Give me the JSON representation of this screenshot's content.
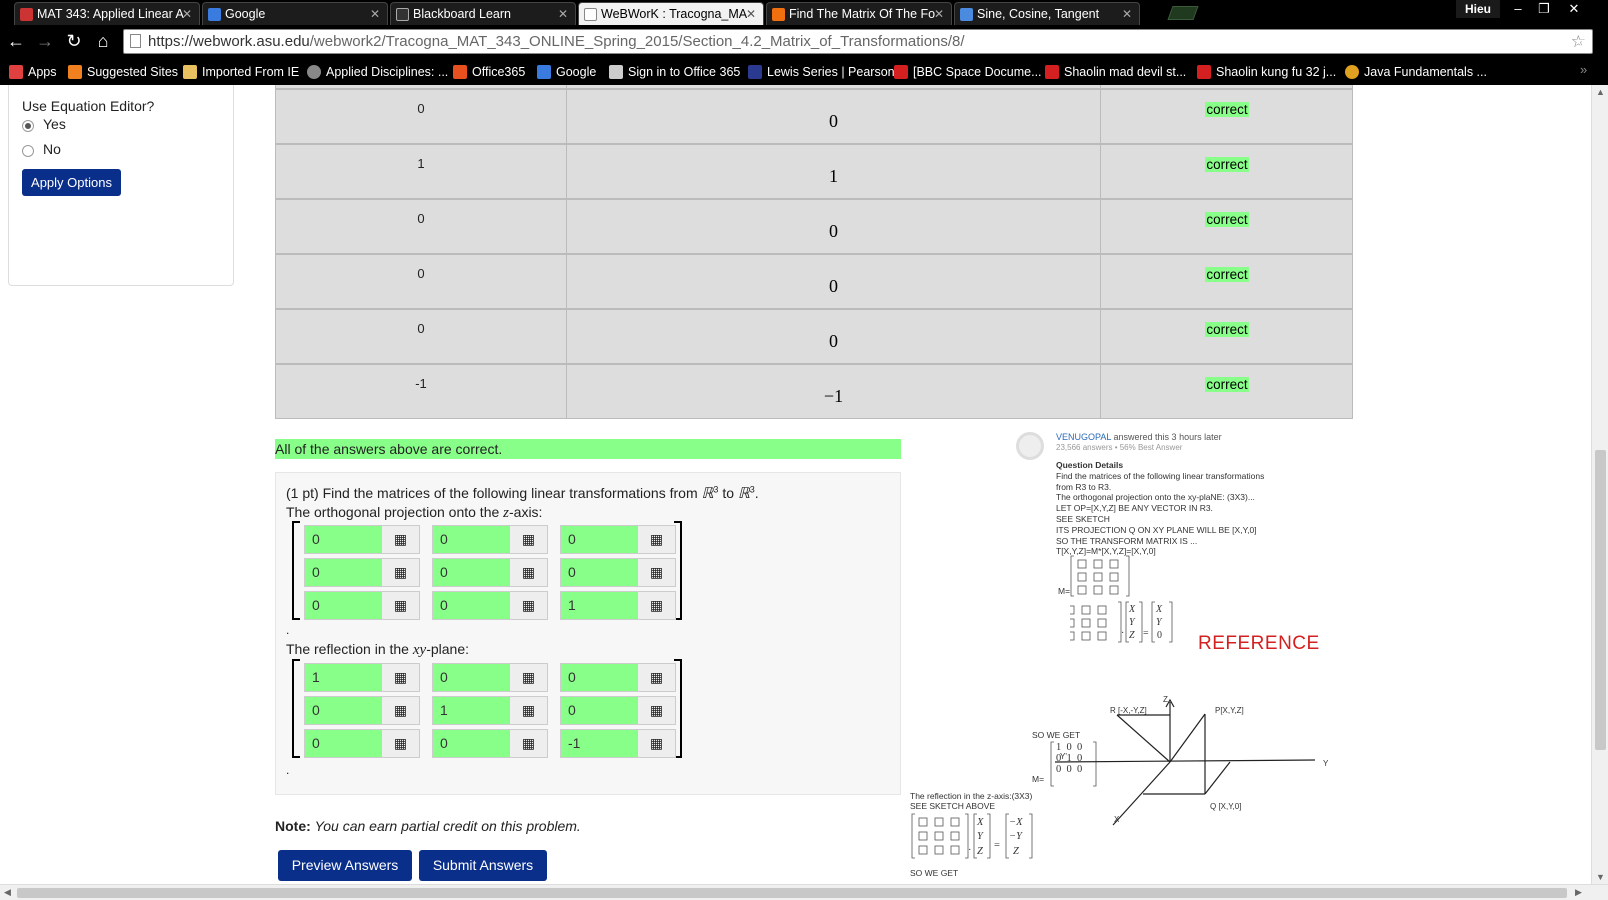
{
  "browser": {
    "tabs": [
      {
        "title": "MAT 343: Applied Linear A",
        "icon": "gmail-icon",
        "color": "#c33"
      },
      {
        "title": "Google",
        "icon": "google-icon",
        "color": "#3a7be0"
      },
      {
        "title": "Blackboard Learn",
        "icon": "blackboard-icon",
        "color": "#333"
      },
      {
        "title": "WeBWorK : Tracogna_MA",
        "icon": "page-icon",
        "color": "#ffffff"
      },
      {
        "title": "Find The Matrix Of The Fo",
        "icon": "chegg-icon",
        "color": "#f07010"
      },
      {
        "title": "Sine, Cosine, Tangent",
        "icon": "mathsisfun-icon",
        "color": "#4a8be0"
      }
    ],
    "profile": "Hieu",
    "url_host": "https://webwork.asu.edu",
    "url_path": "/webwork2/Tracogna_MAT_343_ONLINE_Spring_2015/Section_4.2_Matrix_of_Transformations/8/",
    "bookmarks": [
      {
        "label": "Apps",
        "icon": "apps-icon",
        "color": "#e04040"
      },
      {
        "label": "Suggested Sites",
        "icon": "suggested-icon",
        "color": "#f08020"
      },
      {
        "label": "Imported From IE",
        "icon": "folder-icon",
        "color": "#e8c060"
      },
      {
        "label": "Applied Disciplines: ...",
        "icon": "globe-icon",
        "color": "#888888"
      },
      {
        "label": "Office365",
        "icon": "office-icon",
        "color": "#e85020"
      },
      {
        "label": "Google",
        "icon": "google-icon",
        "color": "#3a7be0"
      },
      {
        "label": "Sign in to Office 365",
        "icon": "office-icon",
        "color": "#cccccc"
      },
      {
        "label": "Lewis Series | Pearson",
        "icon": "pearson-icon",
        "color": "#2a3a90"
      },
      {
        "label": "[BBC Space Docume...",
        "icon": "youtube-icon",
        "color": "#d42020"
      },
      {
        "label": "Shaolin mad devil st...",
        "icon": "youtube-icon",
        "color": "#d42020"
      },
      {
        "label": "Shaolin kung fu 32 j...",
        "icon": "youtube-icon",
        "color": "#d42020"
      },
      {
        "label": "Java Fundamentals ...",
        "icon": "java-icon",
        "color": "#e0a020"
      }
    ]
  },
  "options": {
    "cut_label": "No",
    "title": "Use Equation Editor?",
    "yes": "Yes",
    "no": "No",
    "apply": "Apply Options"
  },
  "results": [
    {
      "entered": "0",
      "preview": "0",
      "result": "correct"
    },
    {
      "entered": "1",
      "preview": "1",
      "result": "correct"
    },
    {
      "entered": "0",
      "preview": "0",
      "result": "correct"
    },
    {
      "entered": "0",
      "preview": "0",
      "result": "correct"
    },
    {
      "entered": "0",
      "preview": "0",
      "result": "correct"
    },
    {
      "entered": "-1",
      "preview": "−1",
      "result": "correct"
    }
  ],
  "all_correct": "All of the answers above are correct.",
  "problem": {
    "intro": "(1 pt) Find the matrices of the following linear transformations from",
    "r3": "ℝ",
    "to": "to",
    "part1": "The orthogonal projection onto the",
    "part1_var": "z",
    "part1_end": "-axis:",
    "matrix1": [
      [
        "0",
        "0",
        "0"
      ],
      [
        "0",
        "0",
        "0"
      ],
      [
        "0",
        "0",
        "1"
      ]
    ],
    "part2": "The reflection in the",
    "part2_var": "xy",
    "part2_end": "-plane:",
    "matrix2": [
      [
        "1",
        "0",
        "0"
      ],
      [
        "0",
        "1",
        "0"
      ],
      [
        "0",
        "0",
        "-1"
      ]
    ],
    "dot": "."
  },
  "note_label": "Note:",
  "note_text": "You can earn partial credit on this problem.",
  "buttons": {
    "preview": "Preview Answers",
    "submit": "Submit Answers"
  },
  "reference": {
    "user": "VENUGOPAL",
    "answered": "answered this 3 hours later",
    "stats": "23,566 answers • 56% Best Answer",
    "qd_title": "Question Details",
    "qd_body": "Find the matrices of the following linear transformations\nfrom R3 to R3.\nThe orthogonal projection onto the xy-plaNE: (3X3)...\nLET OP=[X,Y,Z] BE ANY VECTOR IN R3.\nSEE SKETCH\nITS PROJECTION Q ON XY PLANE WILL BE [X,Y,0]\nSO THE TRANSFORM MATRIX IS ...\nT[X,Y,Z]=M*[X,Y,Z]=[X,Y,0]",
    "m_eq": "M=",
    "so_we_get": "SO WE GET",
    "ref_word": "REFERENCE",
    "reflection_title": "The reflection in the z-axis:(3X3)",
    "see_sketch": "SEE SKETCH ABOVE",
    "so_we_get2": "SO WE GET",
    "axis_z": "Z",
    "axis_y": "Y",
    "axis_yneg": "Y'",
    "axis_x": "X",
    "point_r": "R [-X,-Y,Z]",
    "point_p": "P[X,Y,Z]",
    "point_q": "Q [X,Y,0]",
    "proj_matrix": [
      [
        "1",
        "0",
        "0"
      ],
      [
        "0",
        "1",
        "0"
      ],
      [
        "0",
        "0",
        "0"
      ]
    ],
    "refl_matrix": [
      [
        "−1",
        "0",
        "0"
      ],
      [
        "0",
        "−1",
        "0"
      ],
      [
        "0",
        "0",
        "1"
      ]
    ]
  }
}
